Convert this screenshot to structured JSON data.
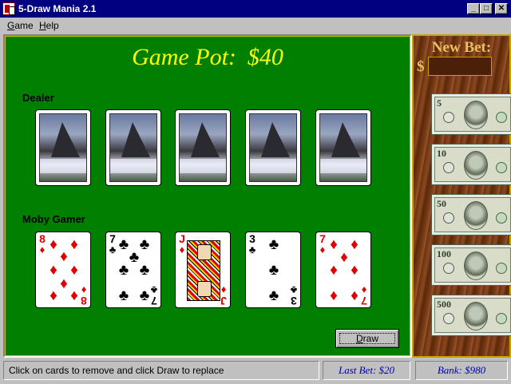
{
  "window": {
    "title": "5-Draw Mania 2.1",
    "minimize_glyph": "_",
    "maximize_glyph": "□",
    "close_glyph": "✕"
  },
  "menu": {
    "items": [
      {
        "label": "Game",
        "accel": "G",
        "rest": "ame"
      },
      {
        "label": "Help",
        "accel": "H",
        "rest": "elp"
      }
    ]
  },
  "table": {
    "pot_label": "Game Pot:",
    "pot_amount": "$40",
    "dealer_label": "Dealer",
    "player_label": "Moby Gamer",
    "felt_color": "#007f00"
  },
  "dealer_cards": [
    {
      "face_down": true
    },
    {
      "face_down": true
    },
    {
      "face_down": true
    },
    {
      "face_down": true
    },
    {
      "face_down": true
    }
  ],
  "player_cards": [
    {
      "rank": "8",
      "suit": "♦",
      "color": "red"
    },
    {
      "rank": "7",
      "suit": "♣",
      "color": "black"
    },
    {
      "rank": "J",
      "suit": "♦",
      "color": "red"
    },
    {
      "rank": "3",
      "suit": "♣",
      "color": "black"
    },
    {
      "rank": "7",
      "suit": "♦",
      "color": "red"
    }
  ],
  "draw_button": {
    "label": "Draw",
    "accel": "D",
    "rest": "raw"
  },
  "bet_panel": {
    "title": "New Bet:",
    "currency_symbol": "$",
    "input_value": "",
    "bills": [
      {
        "denomination": "5"
      },
      {
        "denomination": "10"
      },
      {
        "denomination": "50"
      },
      {
        "denomination": "100"
      },
      {
        "denomination": "500"
      }
    ]
  },
  "status": {
    "message": "Click on cards to remove and click Draw to replace",
    "last_bet": "Last Bet: $20",
    "bank": "Bank: $980"
  }
}
